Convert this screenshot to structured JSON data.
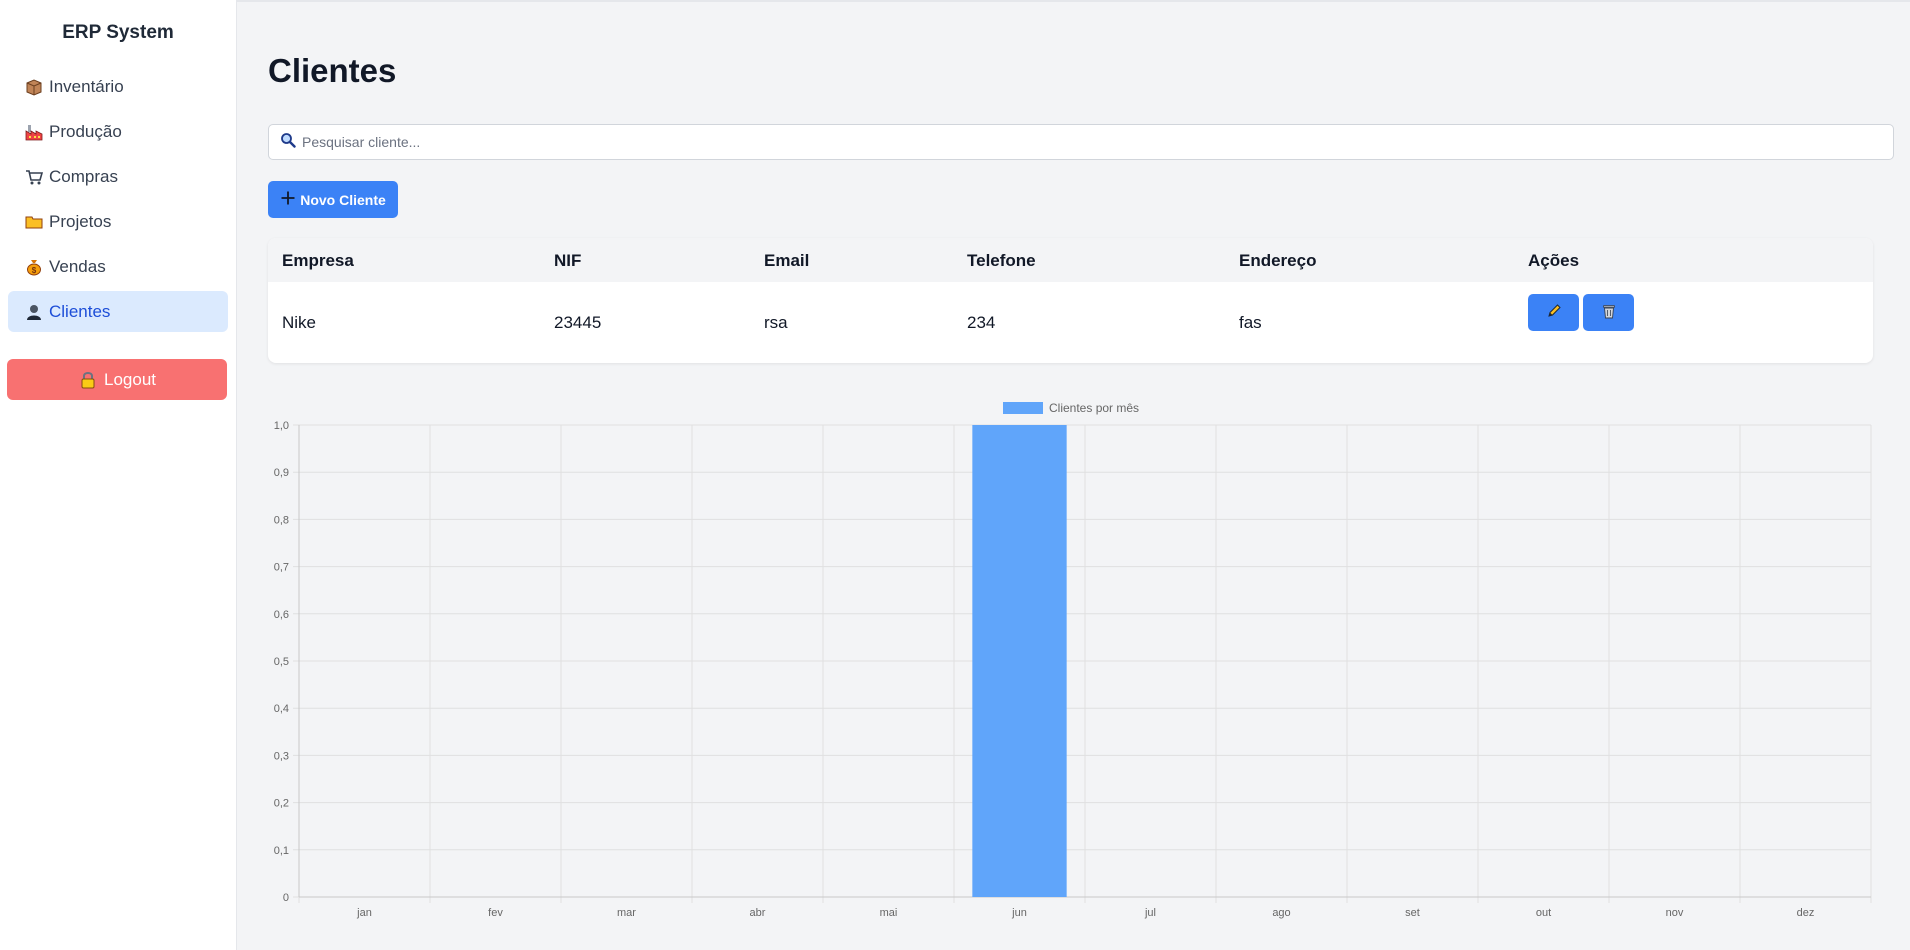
{
  "app": {
    "title": "ERP System"
  },
  "sidebar": {
    "items": [
      {
        "label": "Inventário",
        "icon": "package-icon",
        "active": false
      },
      {
        "label": "Produção",
        "icon": "factory-icon",
        "active": false
      },
      {
        "label": "Compras",
        "icon": "shopping-cart-icon",
        "active": false
      },
      {
        "label": "Projetos",
        "icon": "folder-icon",
        "active": false
      },
      {
        "label": "Vendas",
        "icon": "money-bag-icon",
        "active": false
      },
      {
        "label": "Clientes",
        "icon": "user-icon",
        "active": true
      }
    ],
    "logout_label": "Logout",
    "logout_icon": "lock-icon"
  },
  "page": {
    "title": "Clientes",
    "search_placeholder": "Pesquisar cliente...",
    "search_value": "",
    "search_icon": "search-icon",
    "new_button_label": "Novo Cliente",
    "new_button_icon": "plus-icon"
  },
  "table": {
    "columns": [
      "Empresa",
      "NIF",
      "Email",
      "Telefone",
      "Endereço",
      "Ações"
    ],
    "rows": [
      {
        "empresa": "Nike",
        "nif": "23445",
        "email": "rsa",
        "telefone": "234",
        "endereco": "fas",
        "actions": [
          "edit-icon",
          "trash-icon"
        ]
      }
    ]
  },
  "colors": {
    "accent": "#3b82f6",
    "bar": "#60a5fa",
    "logout": "#f87171",
    "active_bg": "#dbeafe",
    "active_text": "#1d4ed8"
  },
  "chart_data": {
    "type": "bar",
    "categories": [
      "jan",
      "fev",
      "mar",
      "abr",
      "mai",
      "jun",
      "jul",
      "ago",
      "set",
      "out",
      "nov",
      "dez"
    ],
    "series": [
      {
        "name": "Clientes por mês",
        "values": [
          0,
          0,
          0,
          0,
          0,
          1,
          0,
          0,
          0,
          0,
          0,
          0
        ],
        "color": "#60a5fa"
      }
    ],
    "ylim": [
      0,
      1
    ],
    "yticks": [
      "0",
      "0,1",
      "0,2",
      "0,3",
      "0,4",
      "0,5",
      "0,6",
      "0,7",
      "0,8",
      "0,9",
      "1,0"
    ],
    "grid": true,
    "legend": "top-center"
  }
}
